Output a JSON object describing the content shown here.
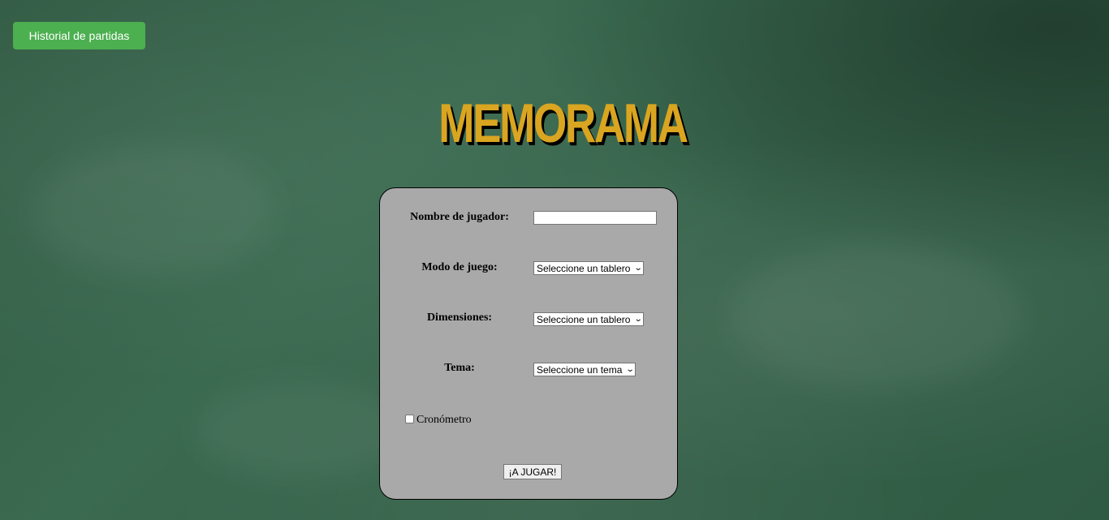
{
  "header": {
    "history_button_label": "Historial de partidas",
    "title": "MEMORAMA"
  },
  "form": {
    "player_name_label": "Nombre de jugador:",
    "player_name_value": "",
    "game_mode_label": "Modo de juego:",
    "game_mode_selected": "Seleccione un tablero",
    "dimensions_label": "Dimensiones:",
    "dimensions_selected": "Seleccione un tablero",
    "theme_label": "Tema:",
    "theme_selected": "Seleccione un tema",
    "timer_label": "Cronómetro",
    "timer_checked": false,
    "play_button_label": "¡A JUGAR!"
  },
  "colors": {
    "board_background": "#356149",
    "history_button": "#4caf50",
    "title": "#daa520",
    "panel": "#a9a9a9"
  },
  "icons": {
    "select_arrow": "chevron-down-icon"
  }
}
